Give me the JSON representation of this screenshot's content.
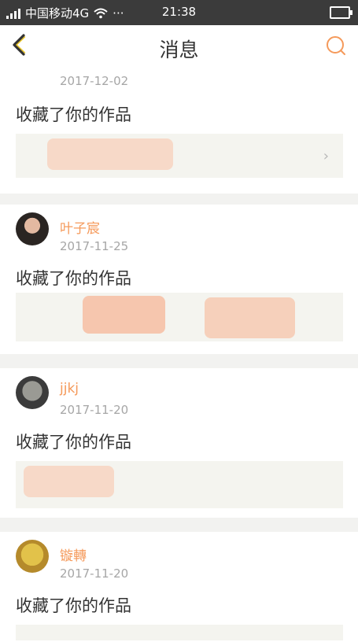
{
  "status_bar": {
    "carrier": "中国移动4G",
    "wifi_icon": "wifi-icon",
    "more": "···",
    "time": "21:38"
  },
  "header": {
    "title": "消息",
    "back_icon": "chevron-left-icon",
    "search_icon": "search-icon"
  },
  "colors": {
    "accent": "#f59a5b",
    "header_bg": "#ffffff",
    "status_bg": "#3b3b3b",
    "date": "#a6a6a6",
    "work_bg": "#f4f4ef"
  },
  "messages": [
    {
      "name": "",
      "date": "2017-12-02",
      "action": "收藏了你的作品",
      "has_arrow": true
    },
    {
      "name": "叶子宸",
      "date": "2017-11-25",
      "action": "收藏了你的作品",
      "has_arrow": false
    },
    {
      "name": "jjkj",
      "date": "2017-11-20",
      "action": "收藏了你的作品",
      "has_arrow": false
    },
    {
      "name": "镟轉",
      "date": "2017-11-20",
      "action": "收藏了你的作品",
      "has_arrow": false
    }
  ]
}
